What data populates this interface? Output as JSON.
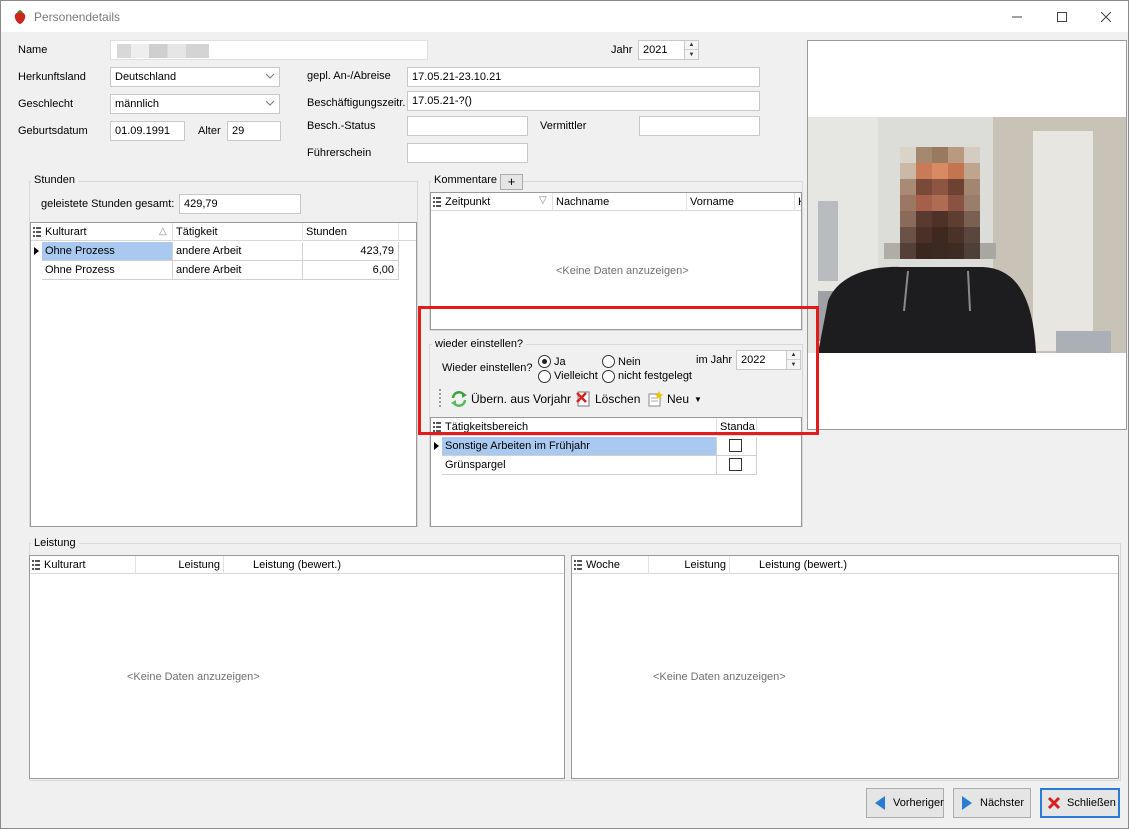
{
  "window": {
    "title": "Personendetails",
    "controls": {
      "minimize": "–",
      "maximize": "☐",
      "close": "✕"
    }
  },
  "form": {
    "name_label": "Name",
    "name_value": "",
    "herkunft_label": "Herkunftsland",
    "herkunft_value": "Deutschland",
    "geschlecht_label": "Geschlecht",
    "geschlecht_value": "männlich",
    "geburtsdatum_label": "Geburtsdatum",
    "geburtsdatum_value": "01.09.1991",
    "alter_label": "Alter",
    "alter_value": "29",
    "jahr_label": "Jahr",
    "jahr_value": "2021",
    "anreise_label": "gepl. An-/Abreise",
    "anreise_value": "17.05.21-23.10.21",
    "beschaeftigung_label": "Beschäftigungszeitr.",
    "beschaeftigung_value": "17.05.21-?()",
    "status_label": "Besch.-Status",
    "status_value": "",
    "vermittler_label": "Vermittler",
    "vermittler_value": "",
    "fuehrerschein_label": "Führerschein",
    "fuehrerschein_value": ""
  },
  "stunden": {
    "title": "Stunden",
    "total_label": "geleistete Stunden gesamt:",
    "total_value": "429,79",
    "columns": [
      "Kulturart",
      "Tätigkeit",
      "Stunden"
    ],
    "rows": [
      {
        "kulturart": "Ohne Prozess",
        "taetigkeit": "andere Arbeit",
        "stunden": "423,79"
      },
      {
        "kulturart": "Ohne Prozess",
        "taetigkeit": "andere Arbeit",
        "stunden": "6,00"
      }
    ]
  },
  "kommentare": {
    "title": "Kommentare",
    "add_label": "+",
    "columns": [
      "Zeitpunkt",
      "Nachname",
      "Vorname",
      "K"
    ],
    "empty": "<Keine Daten anzuzeigen>"
  },
  "wieder": {
    "title": "wieder einstellen?",
    "question_label": "Wieder einstellen?",
    "options": [
      "Ja",
      "Nein",
      "Vielleicht",
      "nicht festgelegt"
    ],
    "selected": "Ja",
    "jahr_label": "im Jahr",
    "jahr_value": "2022",
    "toolbar": {
      "uebern_label": "Übern. aus Vorjahr",
      "loeschen_label": "Löschen",
      "neu_label": "Neu"
    },
    "columns": [
      "Tätigkeitsbereich",
      "Standa"
    ],
    "rows": [
      {
        "bereich": "Sonstige Arbeiten im Frühjahr",
        "standard": false
      },
      {
        "bereich": "Grünspargel",
        "standard": false
      }
    ]
  },
  "leistung": {
    "title": "Leistung",
    "left_columns": [
      "Kulturart",
      "Leistung",
      "Leistung (bewert.)"
    ],
    "right_columns": [
      "Woche",
      "Leistung",
      "Leistung (bewert.)"
    ],
    "left_empty": "<Keine Daten anzuzeigen>",
    "right_empty": "<Keine Daten anzuzeigen>"
  },
  "buttons": {
    "vorheriger": "Vorheriger",
    "naechster": "Nächster",
    "schliessen": "Schließen"
  },
  "colors": {
    "highlight": "#e31b1b",
    "selection": "#a9c9f0",
    "nav_arrow": "#2a7bd4",
    "close_x": "#d62020"
  }
}
